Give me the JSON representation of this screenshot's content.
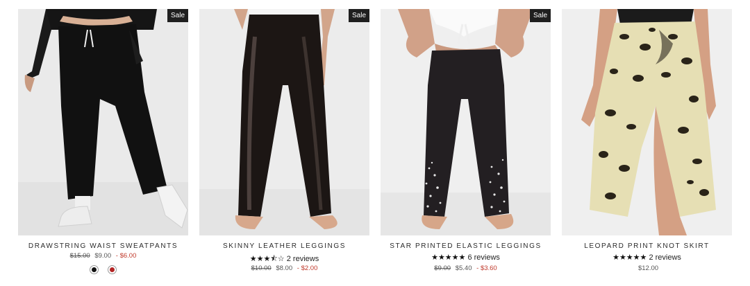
{
  "products": [
    {
      "sale_badge": "Sale",
      "title": "DRAWSTRING WAIST SWEATPANTS",
      "stars": "",
      "reviews": "",
      "price_was": "$15.00",
      "price_now": "$9.00",
      "price_sep": "-",
      "price_sale": "$6.00",
      "swatches": [
        "black",
        "red"
      ]
    },
    {
      "sale_badge": "Sale",
      "title": "SKINNY LEATHER LEGGINGS",
      "stars": "★★★⯪☆",
      "reviews": "2 reviews",
      "price_was": "$10.00",
      "price_now": "$8.00",
      "price_sep": "-",
      "price_sale": "$2.00"
    },
    {
      "sale_badge": "Sale",
      "title": "STAR PRINTED ELASTIC LEGGINGS",
      "stars": "★★★★★",
      "reviews": "6 reviews",
      "price_was": "$9.00",
      "price_now": "$5.40",
      "price_sep": "-",
      "price_sale": "$3.60"
    },
    {
      "sale_badge": "",
      "title": "LEOPARD PRINT KNOT SKIRT",
      "stars": "★★★★★",
      "reviews": "2 reviews",
      "price_was": "",
      "price_now": "$12.00",
      "price_sep": "",
      "price_sale": ""
    }
  ],
  "colors": {
    "sale_red": "#c0392b",
    "badge_bg": "#1f1f1f",
    "swatch_black": "#111111",
    "swatch_red": "#b32424"
  }
}
